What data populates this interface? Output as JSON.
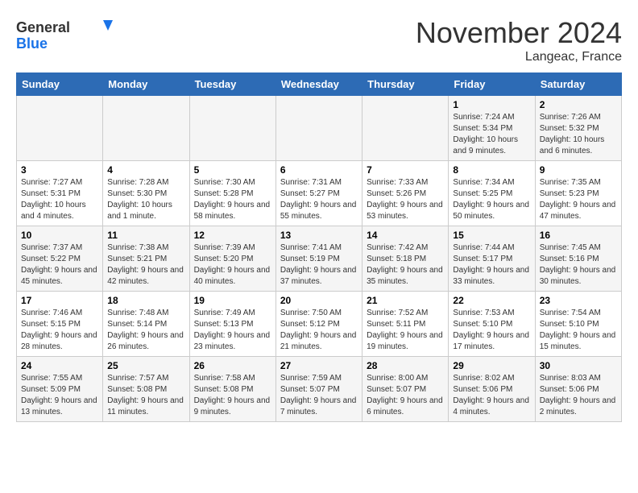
{
  "header": {
    "logo_general": "General",
    "logo_blue": "Blue",
    "month_title": "November 2024",
    "location": "Langeac, France"
  },
  "days_of_week": [
    "Sunday",
    "Monday",
    "Tuesday",
    "Wednesday",
    "Thursday",
    "Friday",
    "Saturday"
  ],
  "weeks": [
    [
      {
        "day": "",
        "info": ""
      },
      {
        "day": "",
        "info": ""
      },
      {
        "day": "",
        "info": ""
      },
      {
        "day": "",
        "info": ""
      },
      {
        "day": "",
        "info": ""
      },
      {
        "day": "1",
        "info": "Sunrise: 7:24 AM\nSunset: 5:34 PM\nDaylight: 10 hours and 9 minutes."
      },
      {
        "day": "2",
        "info": "Sunrise: 7:26 AM\nSunset: 5:32 PM\nDaylight: 10 hours and 6 minutes."
      }
    ],
    [
      {
        "day": "3",
        "info": "Sunrise: 7:27 AM\nSunset: 5:31 PM\nDaylight: 10 hours and 4 minutes."
      },
      {
        "day": "4",
        "info": "Sunrise: 7:28 AM\nSunset: 5:30 PM\nDaylight: 10 hours and 1 minute."
      },
      {
        "day": "5",
        "info": "Sunrise: 7:30 AM\nSunset: 5:28 PM\nDaylight: 9 hours and 58 minutes."
      },
      {
        "day": "6",
        "info": "Sunrise: 7:31 AM\nSunset: 5:27 PM\nDaylight: 9 hours and 55 minutes."
      },
      {
        "day": "7",
        "info": "Sunrise: 7:33 AM\nSunset: 5:26 PM\nDaylight: 9 hours and 53 minutes."
      },
      {
        "day": "8",
        "info": "Sunrise: 7:34 AM\nSunset: 5:25 PM\nDaylight: 9 hours and 50 minutes."
      },
      {
        "day": "9",
        "info": "Sunrise: 7:35 AM\nSunset: 5:23 PM\nDaylight: 9 hours and 47 minutes."
      }
    ],
    [
      {
        "day": "10",
        "info": "Sunrise: 7:37 AM\nSunset: 5:22 PM\nDaylight: 9 hours and 45 minutes."
      },
      {
        "day": "11",
        "info": "Sunrise: 7:38 AM\nSunset: 5:21 PM\nDaylight: 9 hours and 42 minutes."
      },
      {
        "day": "12",
        "info": "Sunrise: 7:39 AM\nSunset: 5:20 PM\nDaylight: 9 hours and 40 minutes."
      },
      {
        "day": "13",
        "info": "Sunrise: 7:41 AM\nSunset: 5:19 PM\nDaylight: 9 hours and 37 minutes."
      },
      {
        "day": "14",
        "info": "Sunrise: 7:42 AM\nSunset: 5:18 PM\nDaylight: 9 hours and 35 minutes."
      },
      {
        "day": "15",
        "info": "Sunrise: 7:44 AM\nSunset: 5:17 PM\nDaylight: 9 hours and 33 minutes."
      },
      {
        "day": "16",
        "info": "Sunrise: 7:45 AM\nSunset: 5:16 PM\nDaylight: 9 hours and 30 minutes."
      }
    ],
    [
      {
        "day": "17",
        "info": "Sunrise: 7:46 AM\nSunset: 5:15 PM\nDaylight: 9 hours and 28 minutes."
      },
      {
        "day": "18",
        "info": "Sunrise: 7:48 AM\nSunset: 5:14 PM\nDaylight: 9 hours and 26 minutes."
      },
      {
        "day": "19",
        "info": "Sunrise: 7:49 AM\nSunset: 5:13 PM\nDaylight: 9 hours and 23 minutes."
      },
      {
        "day": "20",
        "info": "Sunrise: 7:50 AM\nSunset: 5:12 PM\nDaylight: 9 hours and 21 minutes."
      },
      {
        "day": "21",
        "info": "Sunrise: 7:52 AM\nSunset: 5:11 PM\nDaylight: 9 hours and 19 minutes."
      },
      {
        "day": "22",
        "info": "Sunrise: 7:53 AM\nSunset: 5:10 PM\nDaylight: 9 hours and 17 minutes."
      },
      {
        "day": "23",
        "info": "Sunrise: 7:54 AM\nSunset: 5:10 PM\nDaylight: 9 hours and 15 minutes."
      }
    ],
    [
      {
        "day": "24",
        "info": "Sunrise: 7:55 AM\nSunset: 5:09 PM\nDaylight: 9 hours and 13 minutes."
      },
      {
        "day": "25",
        "info": "Sunrise: 7:57 AM\nSunset: 5:08 PM\nDaylight: 9 hours and 11 minutes."
      },
      {
        "day": "26",
        "info": "Sunrise: 7:58 AM\nSunset: 5:08 PM\nDaylight: 9 hours and 9 minutes."
      },
      {
        "day": "27",
        "info": "Sunrise: 7:59 AM\nSunset: 5:07 PM\nDaylight: 9 hours and 7 minutes."
      },
      {
        "day": "28",
        "info": "Sunrise: 8:00 AM\nSunset: 5:07 PM\nDaylight: 9 hours and 6 minutes."
      },
      {
        "day": "29",
        "info": "Sunrise: 8:02 AM\nSunset: 5:06 PM\nDaylight: 9 hours and 4 minutes."
      },
      {
        "day": "30",
        "info": "Sunrise: 8:03 AM\nSunset: 5:06 PM\nDaylight: 9 hours and 2 minutes."
      }
    ]
  ]
}
